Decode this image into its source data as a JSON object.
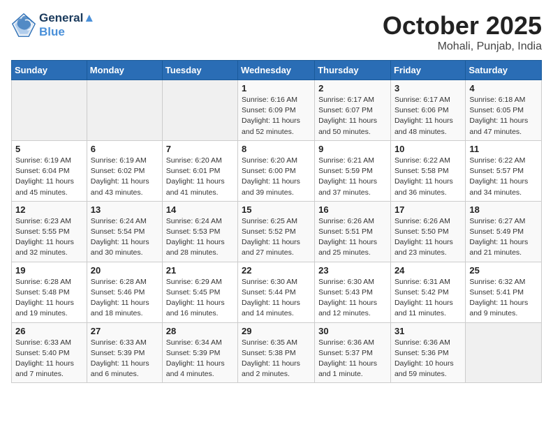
{
  "header": {
    "logo_line1": "General",
    "logo_line2": "Blue",
    "month": "October 2025",
    "location": "Mohali, Punjab, India"
  },
  "days_of_week": [
    "Sunday",
    "Monday",
    "Tuesday",
    "Wednesday",
    "Thursday",
    "Friday",
    "Saturday"
  ],
  "weeks": [
    [
      {
        "day": "",
        "info": ""
      },
      {
        "day": "",
        "info": ""
      },
      {
        "day": "",
        "info": ""
      },
      {
        "day": "1",
        "info": "Sunrise: 6:16 AM\nSunset: 6:09 PM\nDaylight: 11 hours\nand 52 minutes."
      },
      {
        "day": "2",
        "info": "Sunrise: 6:17 AM\nSunset: 6:07 PM\nDaylight: 11 hours\nand 50 minutes."
      },
      {
        "day": "3",
        "info": "Sunrise: 6:17 AM\nSunset: 6:06 PM\nDaylight: 11 hours\nand 48 minutes."
      },
      {
        "day": "4",
        "info": "Sunrise: 6:18 AM\nSunset: 6:05 PM\nDaylight: 11 hours\nand 47 minutes."
      }
    ],
    [
      {
        "day": "5",
        "info": "Sunrise: 6:19 AM\nSunset: 6:04 PM\nDaylight: 11 hours\nand 45 minutes."
      },
      {
        "day": "6",
        "info": "Sunrise: 6:19 AM\nSunset: 6:02 PM\nDaylight: 11 hours\nand 43 minutes."
      },
      {
        "day": "7",
        "info": "Sunrise: 6:20 AM\nSunset: 6:01 PM\nDaylight: 11 hours\nand 41 minutes."
      },
      {
        "day": "8",
        "info": "Sunrise: 6:20 AM\nSunset: 6:00 PM\nDaylight: 11 hours\nand 39 minutes."
      },
      {
        "day": "9",
        "info": "Sunrise: 6:21 AM\nSunset: 5:59 PM\nDaylight: 11 hours\nand 37 minutes."
      },
      {
        "day": "10",
        "info": "Sunrise: 6:22 AM\nSunset: 5:58 PM\nDaylight: 11 hours\nand 36 minutes."
      },
      {
        "day": "11",
        "info": "Sunrise: 6:22 AM\nSunset: 5:57 PM\nDaylight: 11 hours\nand 34 minutes."
      }
    ],
    [
      {
        "day": "12",
        "info": "Sunrise: 6:23 AM\nSunset: 5:55 PM\nDaylight: 11 hours\nand 32 minutes."
      },
      {
        "day": "13",
        "info": "Sunrise: 6:24 AM\nSunset: 5:54 PM\nDaylight: 11 hours\nand 30 minutes."
      },
      {
        "day": "14",
        "info": "Sunrise: 6:24 AM\nSunset: 5:53 PM\nDaylight: 11 hours\nand 28 minutes."
      },
      {
        "day": "15",
        "info": "Sunrise: 6:25 AM\nSunset: 5:52 PM\nDaylight: 11 hours\nand 27 minutes."
      },
      {
        "day": "16",
        "info": "Sunrise: 6:26 AM\nSunset: 5:51 PM\nDaylight: 11 hours\nand 25 minutes."
      },
      {
        "day": "17",
        "info": "Sunrise: 6:26 AM\nSunset: 5:50 PM\nDaylight: 11 hours\nand 23 minutes."
      },
      {
        "day": "18",
        "info": "Sunrise: 6:27 AM\nSunset: 5:49 PM\nDaylight: 11 hours\nand 21 minutes."
      }
    ],
    [
      {
        "day": "19",
        "info": "Sunrise: 6:28 AM\nSunset: 5:48 PM\nDaylight: 11 hours\nand 19 minutes."
      },
      {
        "day": "20",
        "info": "Sunrise: 6:28 AM\nSunset: 5:46 PM\nDaylight: 11 hours\nand 18 minutes."
      },
      {
        "day": "21",
        "info": "Sunrise: 6:29 AM\nSunset: 5:45 PM\nDaylight: 11 hours\nand 16 minutes."
      },
      {
        "day": "22",
        "info": "Sunrise: 6:30 AM\nSunset: 5:44 PM\nDaylight: 11 hours\nand 14 minutes."
      },
      {
        "day": "23",
        "info": "Sunrise: 6:30 AM\nSunset: 5:43 PM\nDaylight: 11 hours\nand 12 minutes."
      },
      {
        "day": "24",
        "info": "Sunrise: 6:31 AM\nSunset: 5:42 PM\nDaylight: 11 hours\nand 11 minutes."
      },
      {
        "day": "25",
        "info": "Sunrise: 6:32 AM\nSunset: 5:41 PM\nDaylight: 11 hours\nand 9 minutes."
      }
    ],
    [
      {
        "day": "26",
        "info": "Sunrise: 6:33 AM\nSunset: 5:40 PM\nDaylight: 11 hours\nand 7 minutes."
      },
      {
        "day": "27",
        "info": "Sunrise: 6:33 AM\nSunset: 5:39 PM\nDaylight: 11 hours\nand 6 minutes."
      },
      {
        "day": "28",
        "info": "Sunrise: 6:34 AM\nSunset: 5:39 PM\nDaylight: 11 hours\nand 4 minutes."
      },
      {
        "day": "29",
        "info": "Sunrise: 6:35 AM\nSunset: 5:38 PM\nDaylight: 11 hours\nand 2 minutes."
      },
      {
        "day": "30",
        "info": "Sunrise: 6:36 AM\nSunset: 5:37 PM\nDaylight: 11 hours\nand 1 minute."
      },
      {
        "day": "31",
        "info": "Sunrise: 6:36 AM\nSunset: 5:36 PM\nDaylight: 10 hours\nand 59 minutes."
      },
      {
        "day": "",
        "info": ""
      }
    ]
  ]
}
